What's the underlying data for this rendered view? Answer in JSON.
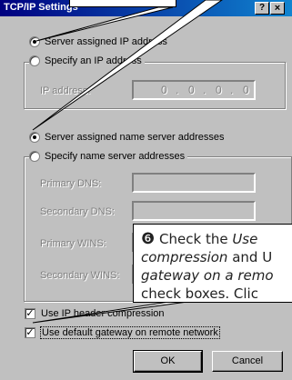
{
  "window": {
    "title": "TCP/IP Settings",
    "help_glyph": "?",
    "close_glyph": "×"
  },
  "ip_section": {
    "option_server_assigned": "Server assigned IP address",
    "option_specify": "Specify an IP address",
    "ip_label": "IP address:",
    "ip_octets": [
      "0",
      "0",
      "0",
      "0"
    ],
    "selected": "server_assigned"
  },
  "dns_section": {
    "option_server_assigned": "Server assigned name server addresses",
    "option_specify": "Specify name server addresses",
    "fields": [
      {
        "label": "Primary DNS:"
      },
      {
        "label": "Secondary DNS:"
      },
      {
        "label": "Primary WINS:"
      },
      {
        "label": "Secondary WINS:"
      }
    ]
  },
  "checkboxes": {
    "ip_header_compression": {
      "label": "Use IP header compression",
      "checked": true
    },
    "default_gateway": {
      "label": "Use default gateway on remote network",
      "checked": true
    }
  },
  "buttons": {
    "ok": "OK",
    "cancel": "Cancel"
  },
  "callout": {
    "step_number": "❻",
    "line1_pre": "Check the ",
    "line1_em": "Use",
    "line2_em": "compression",
    "line2_post": " and U",
    "line3_em": "gateway on a remo",
    "line4": "check boxes. Clic"
  },
  "colors": {
    "titlebar_start": "#000080",
    "titlebar_end": "#1084d0",
    "face": "#c0c0c0"
  }
}
